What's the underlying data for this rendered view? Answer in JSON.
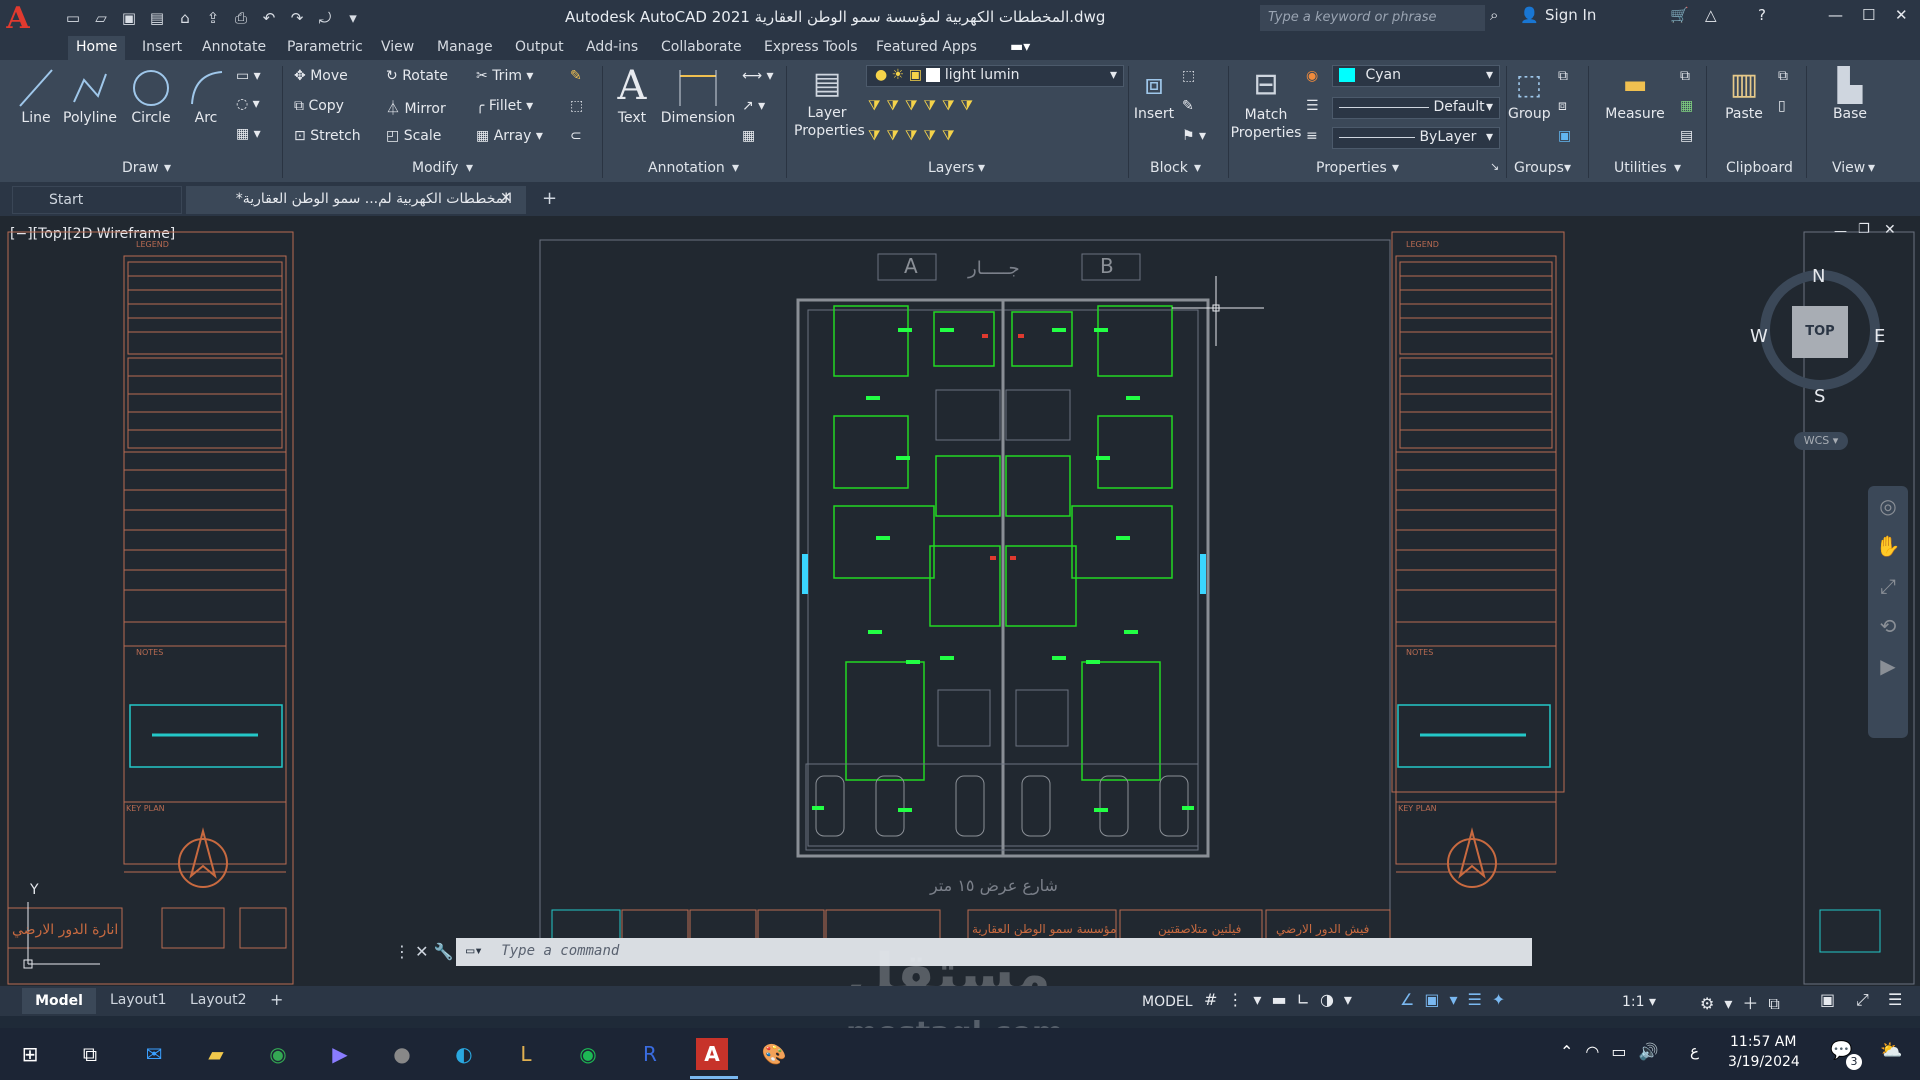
{
  "app": {
    "title": "Autodesk AutoCAD 2021  المخططات الكهربية لمؤسسة سمو الوطن العقارية.dwg"
  },
  "search": {
    "placeholder": "Type a keyword or phrase"
  },
  "account": {
    "signin": "Sign In"
  },
  "menu_tabs": [
    "Home",
    "Insert",
    "Annotate",
    "Parametric",
    "View",
    "Manage",
    "Output",
    "Add-ins",
    "Collaborate",
    "Express Tools",
    "Featured Apps"
  ],
  "ribbon": {
    "draw": {
      "line": "Line",
      "polyline": "Polyline",
      "circle": "Circle",
      "arc": "Arc",
      "label": "Draw"
    },
    "modify": {
      "move": "Move",
      "rotate": "Rotate",
      "trim": "Trim",
      "copy": "Copy",
      "mirror": "Mirror",
      "fillet": "Fillet",
      "stretch": "Stretch",
      "scale": "Scale",
      "array": "Array",
      "label": "Modify"
    },
    "annotation": {
      "text": "Text",
      "dimension": "Dimension",
      "label": "Annotation"
    },
    "layers": {
      "layer_properties": "Layer Properties",
      "current_layer": "light lumin",
      "label": "Layers"
    },
    "block": {
      "insert": "Insert",
      "label": "Block"
    },
    "properties": {
      "match": "Match Properties",
      "color": "Cyan",
      "linetype": "Default",
      "lineweight": "ByLayer",
      "label": "Properties"
    },
    "groups": {
      "group": "Group",
      "label": "Groups"
    },
    "utilities": {
      "measure": "Measure",
      "label": "Utilities"
    },
    "clipboard": {
      "paste": "Paste",
      "label": "Clipboard"
    },
    "view": {
      "base": "Base",
      "label": "View"
    }
  },
  "doc_tabs": {
    "start": "Start",
    "file": "المخططات الكهربية لم... سمو الوطن العقارية*"
  },
  "viewport": {
    "label": "[−][Top][2D Wireframe]"
  },
  "viewcube": {
    "n": "N",
    "s": "S",
    "e": "E",
    "w": "W",
    "top": "TOP",
    "wcs": "WCS"
  },
  "drawing": {
    "street_label": "شارع عرض ١٥ متر",
    "neighbor_label": "جـــــار",
    "marker_a": "A",
    "marker_b": "B",
    "title_left": "انارة الدور الارضي",
    "title_block_owner": "مؤسسة سمو الوطن العقارية",
    "title_block_project": "فيلتين متلاصقتين",
    "title_block_sheet": "فيش الدور الارضي",
    "legend": "LEGEND",
    "notes": "NOTES",
    "key_plan": "KEY PLAN"
  },
  "command": {
    "placeholder": "Type a command"
  },
  "layout_tabs": [
    "Model",
    "Layout1",
    "Layout2"
  ],
  "status": {
    "model": "MODEL",
    "scale": "1:1"
  },
  "watermark": {
    "brand": "مستقل",
    "site": "mostaql.com"
  },
  "taskbar": {
    "time": "11:57 AM",
    "date": "3/19/2024",
    "lang": "ع",
    "notif": "3"
  },
  "colors": {
    "accent": "#e03a2f",
    "cyan": "#00ffff",
    "green": "#22d822",
    "frame": "#b96b52"
  }
}
